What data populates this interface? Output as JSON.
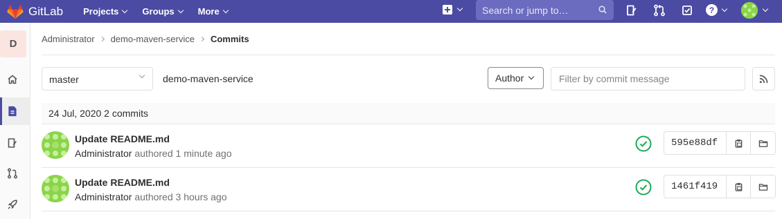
{
  "topbar": {
    "brand": "GitLab",
    "menu": [
      {
        "label": "Projects"
      },
      {
        "label": "Groups"
      },
      {
        "label": "More"
      }
    ],
    "search_placeholder": "Search or jump to…",
    "help_glyph": "?"
  },
  "sidebar": {
    "project_initial": "D",
    "items": [
      {
        "icon": "home-icon"
      },
      {
        "icon": "repository-icon"
      },
      {
        "icon": "issues-icon"
      },
      {
        "icon": "merge-request-icon"
      },
      {
        "icon": "rocket-icon"
      }
    ]
  },
  "breadcrumb": {
    "items": [
      "Administrator",
      "demo-maven-service"
    ],
    "current": "Commits"
  },
  "controls": {
    "branch": "master",
    "project": "demo-maven-service",
    "author_label": "Author",
    "filter_placeholder": "Filter by commit message"
  },
  "day": {
    "header": "24 Jul, 2020 2 commits"
  },
  "commits": [
    {
      "title": "Update README.md",
      "author": "Administrator",
      "verb": "authored",
      "time": "1 minute ago",
      "sha": "595e88df",
      "status": "passed"
    },
    {
      "title": "Update README.md",
      "author": "Administrator",
      "verb": "authored",
      "time": "3 hours ago",
      "sha": "1461f419",
      "status": "passed"
    }
  ],
  "colors": {
    "navbar": "#4b4ba3",
    "success": "#1aaa55",
    "avatar_green": "#8bd44a"
  }
}
